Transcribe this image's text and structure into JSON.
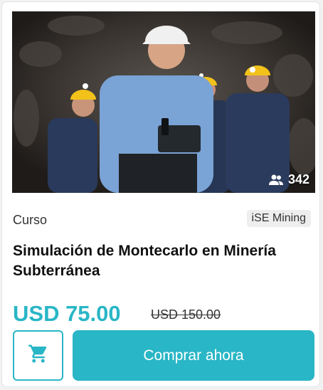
{
  "course": {
    "student_count": "342",
    "type_label": "Curso",
    "provider": "iSE Mining",
    "title": "Simulación de Montecarlo en Minería Subterránea",
    "price": "USD 75.00",
    "old_price": "USD 150.00",
    "buy_label": "Comprar ahora"
  },
  "icons": {
    "students": "people-icon",
    "cart": "shopping-cart-icon"
  },
  "colors": {
    "accent": "#29b6c6",
    "text": "#111111",
    "muted": "#333333",
    "badge_bg": "#eeeeee"
  }
}
